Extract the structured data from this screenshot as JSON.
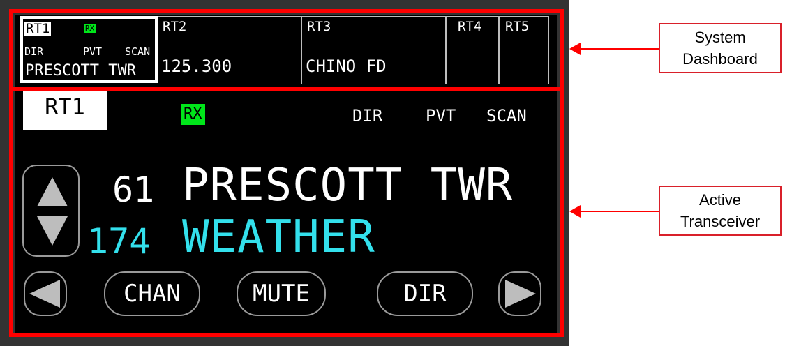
{
  "dashboard": {
    "rt1": {
      "label": "RT1",
      "rx": "RX",
      "dir": "DIR",
      "pvt": "PVT",
      "scan": "SCAN",
      "value": "PRESCOTT TWR"
    },
    "rt2": {
      "label": "RT2",
      "value": "125.300"
    },
    "rt3": {
      "label": "RT3",
      "value": "CHINO FD"
    },
    "rt4": {
      "label": "RT4"
    },
    "rt5": {
      "label": "RT5"
    }
  },
  "transceiver": {
    "label": "RT1",
    "rx": "RX",
    "modes": {
      "dir": "DIR",
      "pvt": "PVT",
      "scan": "SCAN"
    },
    "active_channel": {
      "number": "61",
      "name": "PRESCOTT TWR"
    },
    "next_channel": {
      "number": "174",
      "name": "WEATHER"
    },
    "buttons": {
      "chan": "CHAN",
      "mute": "MUTE",
      "dir": "DIR"
    }
  },
  "annotations": {
    "system_dashboard": [
      "System",
      "Dashboard"
    ],
    "active_transceiver": [
      "Active",
      "Transceiver"
    ]
  },
  "colors": {
    "rx_indicator": "#00e61a",
    "next_channel": "#33e0ec",
    "highlight": "#ff0000"
  }
}
